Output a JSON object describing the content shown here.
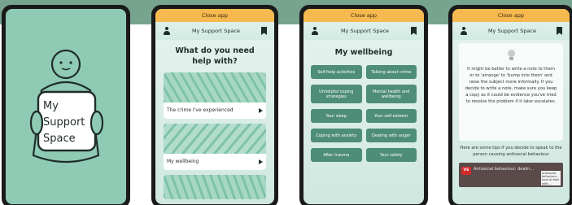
{
  "splash": {
    "logo_line1": "My",
    "logo_line2": "Support",
    "logo_line3": "Space"
  },
  "common": {
    "close_label": "Close app",
    "app_title": "My Support Space"
  },
  "help_screen": {
    "heading": "What do you need help with?",
    "cards": [
      {
        "label": "The crime I've experienced"
      },
      {
        "label": "My wellbeing"
      }
    ]
  },
  "wellbeing_screen": {
    "heading": "My wellbeing",
    "buttons": [
      "Self-help activities",
      "Talking about crime",
      "Unhelpful coping strategies",
      "Mental health and wellbeing",
      "Your sleep",
      "Your self-esteem",
      "Coping with anxiety",
      "Dealing with anger",
      "After trauma",
      "Your safety"
    ]
  },
  "tip_screen": {
    "body": "It might be better to write a note to them or to 'arrange' to 'bump into them' and raise the subject more informally. If you decide to write a note, make sure you keep a copy as it could be evidence you've tried to resolve the problem if it later escalates.",
    "tips_intro": "Here are some tips if you decide to speak to the person causing antisocial behaviour",
    "video_badge": "VS",
    "video_title": "Antisocial behaviour: dealin...",
    "video_side": "Antisocial behaviour: how to deal with..."
  },
  "colors": {
    "brand_green": "#76a48f",
    "topbar": "#f5b94f",
    "button_green": "#4e8d77"
  }
}
